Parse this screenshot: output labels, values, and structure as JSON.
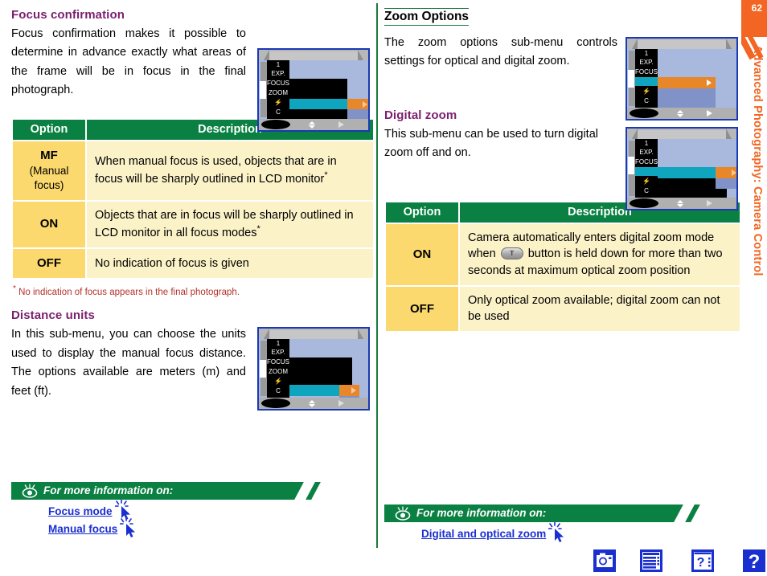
{
  "page": {
    "number": "62",
    "side_tab_text": "Advanced Photography: Camera Control"
  },
  "left_column": {
    "section1": {
      "heading": "Focus confirmation",
      "body": "Focus confirmation makes it possible to determine in advance exactly what areas of the frame will be in focus in the final photograph.",
      "table": {
        "headers": [
          "Option",
          "Description"
        ],
        "rows": [
          {
            "option": "MF",
            "option_sub": "(Manual focus)",
            "description": "When manual focus is used, objects that are in focus will be sharply outlined in LCD monitor",
            "has_asterisk": true
          },
          {
            "option": "ON",
            "option_sub": "",
            "description": "Objects that are in focus will be sharply outlined in LCD monitor in all focus modes",
            "has_asterisk": true
          },
          {
            "option": "OFF",
            "option_sub": "",
            "description": "No indication of focus is given",
            "has_asterisk": false
          }
        ]
      },
      "footnote": "No indication of focus appears in the final photograph."
    },
    "section2": {
      "heading": "Distance units",
      "body": "In this sub-menu, you can choose the units used to display the manual focus distance. The options available are meters (m) and feet (ft)."
    },
    "info_banner": {
      "title": "For more information on:",
      "links": [
        "Focus mode",
        "Manual focus"
      ]
    }
  },
  "right_column": {
    "section1": {
      "heading": "Zoom Options",
      "body": "The zoom options sub-menu controls settings for optical and digital zoom."
    },
    "section2": {
      "heading": "Digital zoom",
      "body": "This sub-menu can be used to turn digital zoom off and on.",
      "table": {
        "headers": [
          "Option",
          "Description"
        ],
        "rows": [
          {
            "option": "ON",
            "description_part1": "Camera automatically enters digital zoom mode when",
            "button_label": "T",
            "description_part2": "button is held down for more than two seconds at maximum optical zoom position"
          },
          {
            "option": "OFF",
            "description_part1": "Only optical zoom available; digital zoom can not be used",
            "button_label": "",
            "description_part2": ""
          }
        ]
      }
    },
    "info_banner": {
      "title": "For more information on:",
      "links": [
        "Digital and optical zoom"
      ]
    }
  },
  "lcd_screens": {
    "menu_tabs": [
      "1",
      "EXP.",
      "FOCUS",
      "ZOOM",
      "§",
      "C"
    ],
    "screen1": {
      "name": "focus-confirmation-menu",
      "highlight_row": 4
    },
    "screen2": {
      "name": "zoom-options-menu",
      "highlight_tab": "ZOOM"
    },
    "screen3": {
      "name": "digital-zoom-menu",
      "highlight_tab": "ZOOM"
    },
    "screen4": {
      "name": "distance-units-menu",
      "highlight_row": 5
    }
  },
  "footer": {
    "icons": [
      "camera-icon",
      "menu-list-icon",
      "help-index-icon",
      "help-question-icon"
    ]
  },
  "colors": {
    "heading_purple": "#7b1f6e",
    "table_header_green": "#0a8043",
    "option_yellow": "#fbd96e",
    "description_cream": "#fcf2c8",
    "tab_orange": "#f26522",
    "link_blue": "#1a2fd0",
    "footnote_red": "#b4312a",
    "divider_green": "#1a7a3c"
  }
}
